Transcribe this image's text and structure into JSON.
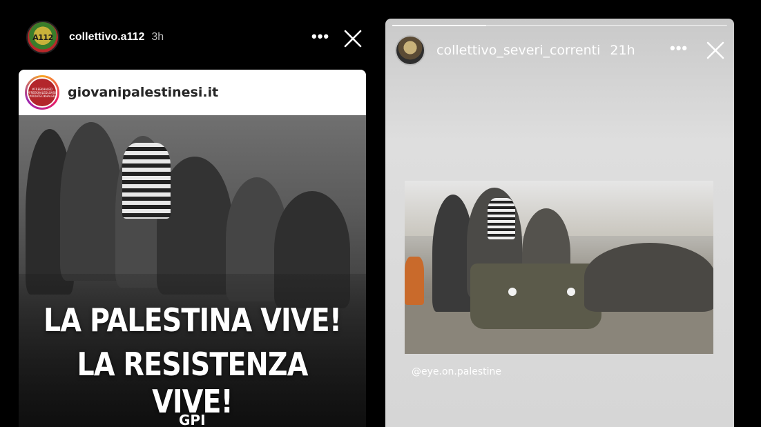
{
  "left_story": {
    "username": "collettivo.a112",
    "time": "3h",
    "avatar_text": "A112",
    "more_label": "•••",
    "shared_post": {
      "username": "giovanipalestinesi.it",
      "avatar_text": [
        "#FREEKHALED",
        "#FREEKHALEDLOASID",
        "#RIDATECIKHALED"
      ],
      "headline_line1": "LA PALESTINA VIVE!",
      "headline_line2": "LA RESISTENZA VIVE!",
      "logo_text": "GPI"
    }
  },
  "right_story": {
    "username": "collettivo_severi_correnti",
    "time": "21h",
    "more_label": "•••",
    "progress": 0.28,
    "mention": "@eye.on.palestine"
  },
  "colors": {
    "background": "#000000",
    "right_story_bg": "#d6d6d6",
    "post_header_bg": "#ffffff",
    "gpi_red": "#b3262b"
  }
}
